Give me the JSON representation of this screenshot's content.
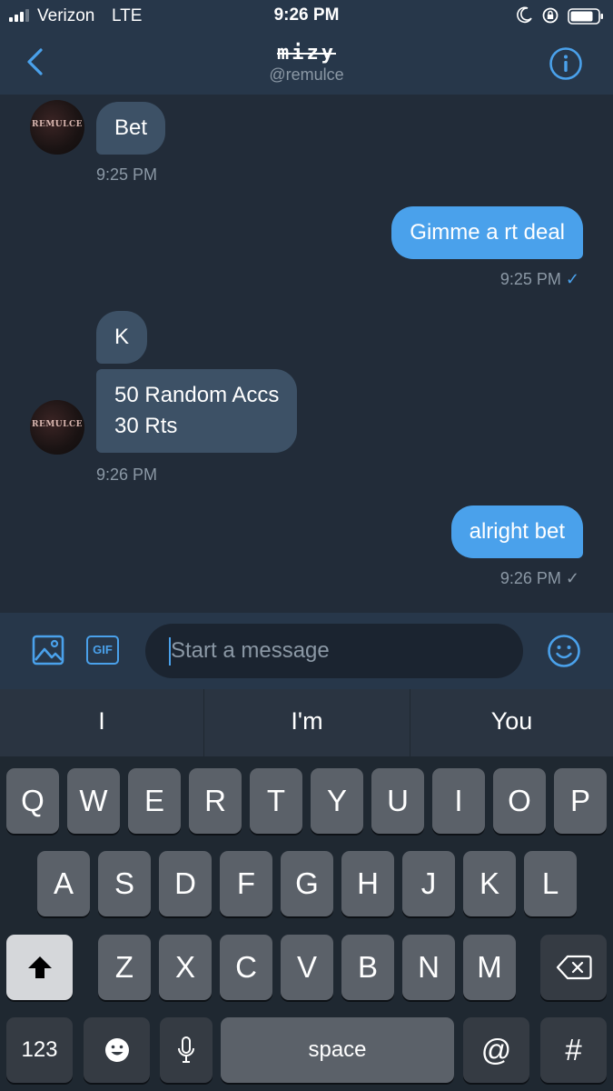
{
  "status_bar": {
    "carrier": "Verizon",
    "network": "LTE",
    "time": "9:26 PM"
  },
  "header": {
    "title": "mizy",
    "handle": "@remulce",
    "back_icon": "chevron-left-icon",
    "info_icon": "info-icon"
  },
  "avatar_text": "REMULCE",
  "messages": [
    {
      "direction": "in",
      "text": "Bet",
      "time": "9:25 PM"
    },
    {
      "direction": "out",
      "text": "Gimme a rt deal",
      "time": "9:25 PM",
      "status": "✓"
    },
    {
      "direction": "in",
      "text": "K"
    },
    {
      "direction": "in",
      "text": "50 Random Accs\n30 Rts",
      "time": "9:26 PM"
    },
    {
      "direction": "out",
      "text": "alright bet",
      "time": "9:26 PM",
      "status": "✓"
    }
  ],
  "composer": {
    "placeholder": "Start a message",
    "gif_label": "GIF",
    "media_icon": "image-icon",
    "emoji_icon": "smiley-icon"
  },
  "keyboard": {
    "suggestions": [
      "I",
      "I'm",
      "You"
    ],
    "row1": [
      "Q",
      "W",
      "E",
      "R",
      "T",
      "Y",
      "U",
      "I",
      "O",
      "P"
    ],
    "row2": [
      "A",
      "S",
      "D",
      "F",
      "G",
      "H",
      "J",
      "K",
      "L"
    ],
    "row3": [
      "Z",
      "X",
      "C",
      "V",
      "B",
      "N",
      "M"
    ],
    "numbers_label": "123",
    "space_label": "space",
    "at_label": "@",
    "hash_label": "#"
  },
  "colors": {
    "accent": "#4aa1eb",
    "background": "#222c39",
    "header": "#27374a",
    "incoming_bubble": "#3d5166"
  }
}
